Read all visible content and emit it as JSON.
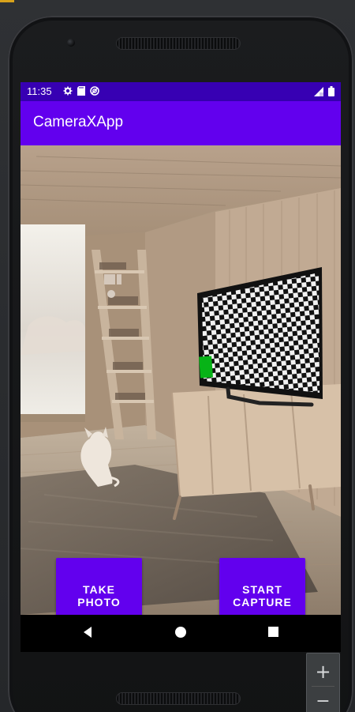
{
  "device": {
    "status_bar": {
      "time": "11:35",
      "icons_left": [
        "settings-icon",
        "sd-card-icon",
        "sync-icon"
      ],
      "icons_right": [
        "signal-icon",
        "battery-icon"
      ]
    },
    "navigation": {
      "back_icon": "back-icon",
      "home_icon": "home-icon",
      "recent_icon": "recent-apps-icon"
    }
  },
  "app": {
    "title": "CameraXApp",
    "buttons": {
      "take_photo": "TAKE\nPHOTO",
      "start_capture": "START\nCAPTURE"
    }
  },
  "emulator": {
    "zoom_in": "+",
    "zoom_out": "−"
  },
  "colors": {
    "status_bar": "#3700b3",
    "app_bar": "#6200ee",
    "button": "#6200ee",
    "phone_frame": "#1b1c1e"
  }
}
